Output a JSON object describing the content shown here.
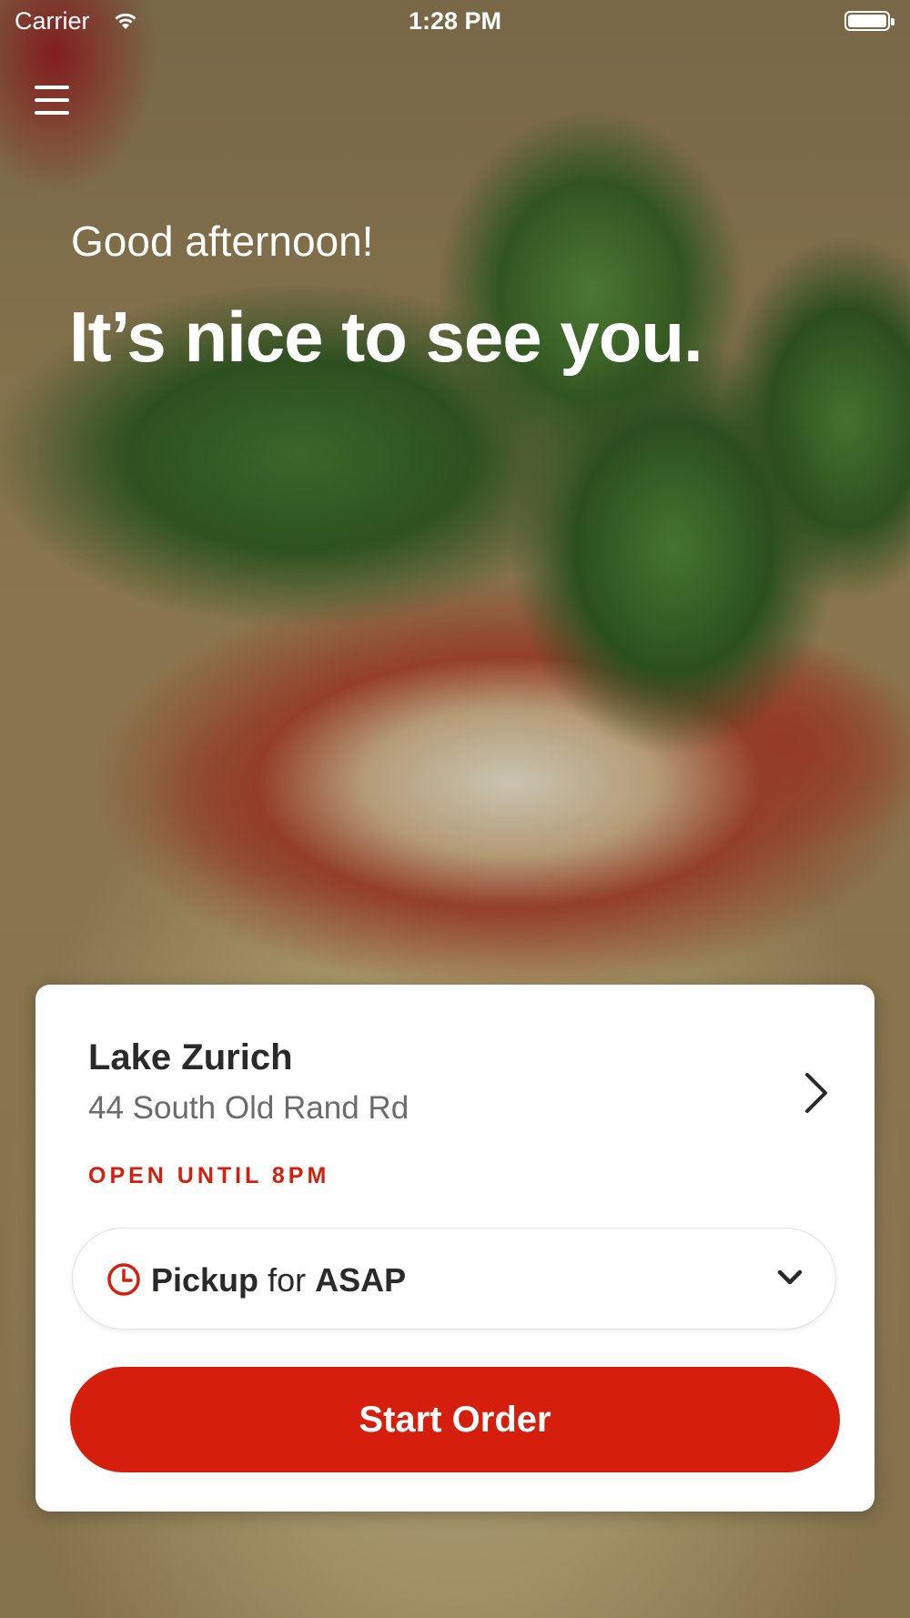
{
  "status_bar": {
    "carrier": "Carrier",
    "time": "1:28 PM"
  },
  "hero": {
    "greeting": "Good afternoon!",
    "headline": "It’s nice to see you."
  },
  "location": {
    "name": "Lake Zurich",
    "address": "44 South Old Rand Rd",
    "hours": "OPEN UNTIL 8PM"
  },
  "order_mode": {
    "mode": "Pickup",
    "connector": "for",
    "time": "ASAP"
  },
  "start_button": {
    "label": "Start Order"
  },
  "colors": {
    "accent": "#d51f0c",
    "text_dark": "#2a2a2a",
    "text_muted": "#6b6b6b"
  }
}
